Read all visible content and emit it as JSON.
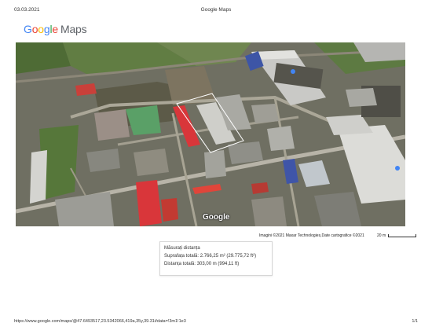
{
  "header": {
    "date": "03.03.2021",
    "title": "Google Maps"
  },
  "logo": {
    "text": "Google Maps",
    "letters": [
      "G",
      "o",
      "o",
      "g",
      "l",
      "e"
    ],
    "maps": "Maps"
  },
  "map": {
    "type": "satellite",
    "wordmark": "Google",
    "attribution": "Imagini ©2021 Maxar Technologies,Date cartografice ©2021",
    "scale_label": "20 m",
    "place_labels": []
  },
  "measure": {
    "title": "Măsurați distanța",
    "area": "Suprafața totală: 2.766,25 m² (29.775,72 ft²)",
    "distance": "Distanța totală: 303,00 m (994,11 ft)"
  },
  "footer": {
    "url": "https://www.google.com/maps/@47.6493517,23.5342066,419a,35y,39.31t/data=!3m1!1e3",
    "page": "1/1"
  },
  "colors": {
    "red_roofs": "#d9363a",
    "vegetation": "#5a7a3c",
    "roads": "#b3b0a4",
    "measurement_line": "#ffffff"
  }
}
